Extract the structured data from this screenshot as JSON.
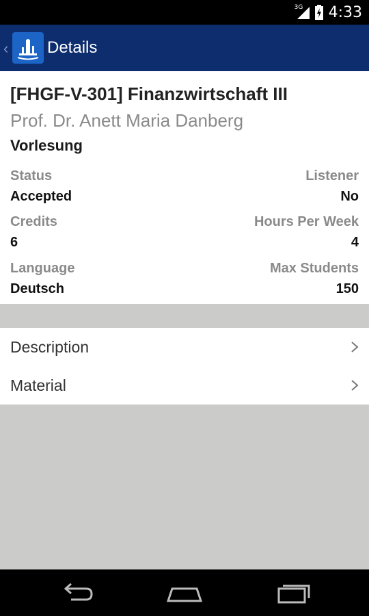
{
  "statusbar": {
    "network_tag": "3G",
    "time": "4:33"
  },
  "appbar": {
    "title": "Details",
    "up_icon": "chevron-left-icon",
    "logo_icon": "app-logo"
  },
  "course": {
    "title": "[FHGF-V-301] Finanzwirtschaft III",
    "lecturer": "Prof. Dr. Anett Maria Danberg",
    "type": "Vorlesung"
  },
  "fields": {
    "status_label": "Status",
    "status_value": "Accepted",
    "listener_label": "Listener",
    "listener_value": "No",
    "credits_label": "Credits",
    "credits_value": "6",
    "hours_label": "Hours Per Week",
    "hours_value": "4",
    "language_label": "Language",
    "language_value": "Deutsch",
    "max_students_label": "Max Students",
    "max_students_value": "150"
  },
  "links": [
    {
      "label": "Description",
      "icon": "chevron-right-icon"
    },
    {
      "label": "Material",
      "icon": "chevron-right-icon"
    }
  ],
  "colors": {
    "appbar": "#0d2d6e",
    "logo": "#1c64c6",
    "background": "#cbccc9"
  }
}
